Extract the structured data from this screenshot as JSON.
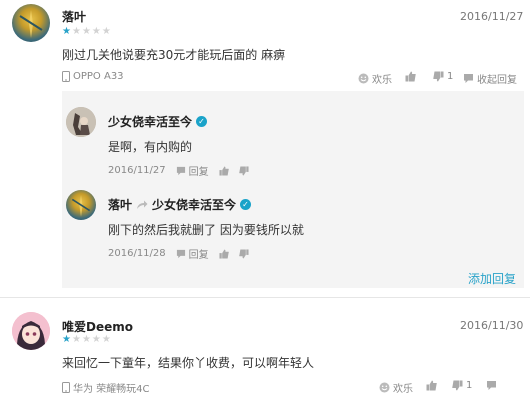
{
  "comment1": {
    "user": "落叶",
    "date": "2016/11/27",
    "rating": 1,
    "text": "刚过几关他说要充30元才能玩后面的 麻痹",
    "device": "OPPO A33",
    "fun_label": "欢乐",
    "dislike_count": "1",
    "collapse_label": "收起回复"
  },
  "reply1": {
    "user": "少女侥幸活至今",
    "text": "是啊，有内购的",
    "date": "2016/11/27",
    "reply_label": "回复"
  },
  "reply2": {
    "user": "落叶",
    "to_user": "少女侥幸活至今",
    "text": "刚下的然后我就删了 因为要钱所以就",
    "date": "2016/11/28",
    "reply_label": "回复"
  },
  "add_reply_label": "添加回复",
  "comment2": {
    "user": "唯爱Deemo",
    "date": "2016/11/30",
    "rating": 1,
    "text": "来回忆一下童年，结果你丫收费，可以啊年轻人",
    "device": "华为 荣耀畅玩4C",
    "fun_label": "欢乐",
    "dislike_count": "1"
  },
  "colors": {
    "accent": "#2aa3c9",
    "verified": "#1aa3c9"
  },
  "icons": [
    "phone-icon",
    "happy-face-icon",
    "thumb-up-icon",
    "thumb-down-icon",
    "comment-icon",
    "reply-arrow-icon",
    "verified-icon",
    "more-icon"
  ]
}
